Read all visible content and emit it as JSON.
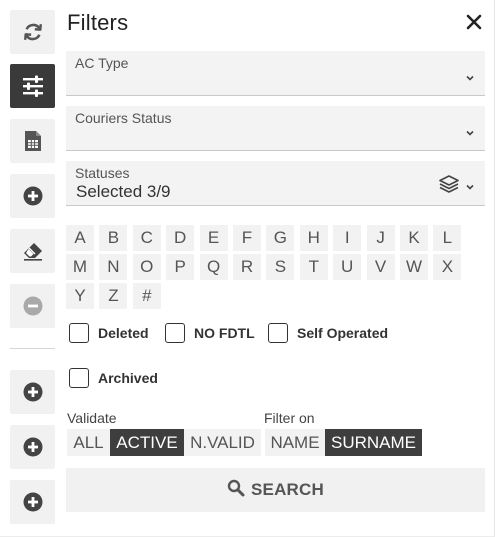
{
  "panel": {
    "title": "Filters"
  },
  "rail": {
    "items": [
      {
        "icon": "refresh-icon",
        "active": false
      },
      {
        "icon": "sliders-icon",
        "active": true
      },
      {
        "icon": "spreadsheet-icon",
        "active": false
      },
      {
        "icon": "plus-circle-icon",
        "active": false
      },
      {
        "icon": "eraser-icon",
        "active": false
      },
      {
        "icon": "minus-circle-icon",
        "active": false
      },
      {
        "icon": "plus-circle-icon",
        "active": false
      },
      {
        "icon": "plus-circle-icon",
        "active": false
      },
      {
        "icon": "plus-circle-icon",
        "active": false
      }
    ]
  },
  "fields": {
    "ac_type": {
      "label": "AC Type",
      "value": ""
    },
    "couriers_status": {
      "label": "Couriers Status",
      "value": ""
    },
    "statuses": {
      "label": "Statuses",
      "value": "Selected 3/9"
    }
  },
  "letters": [
    "A",
    "B",
    "C",
    "D",
    "E",
    "F",
    "G",
    "H",
    "I",
    "J",
    "K",
    "L",
    "M",
    "N",
    "O",
    "P",
    "Q",
    "R",
    "S",
    "T",
    "U",
    "V",
    "W",
    "X",
    "Y",
    "Z",
    "#"
  ],
  "checkboxes": {
    "deleted": {
      "label": "Deleted",
      "checked": false
    },
    "no_fdtl": {
      "label": "NO FDTL",
      "checked": false
    },
    "self_operated": {
      "label": "Self Operated",
      "checked": false
    },
    "archived": {
      "label": "Archived",
      "checked": false
    }
  },
  "validate": {
    "label": "Validate",
    "options": [
      "ALL",
      "ACTIVE",
      "N.VALID"
    ],
    "selected": "ACTIVE"
  },
  "filter_on": {
    "label": "Filter on",
    "options": [
      "NAME",
      "SURNAME"
    ],
    "selected": "SURNAME"
  },
  "search": {
    "label": "SEARCH"
  },
  "colors": {
    "active_bg": "#3e3e3e",
    "field_bg": "#f3f3f3",
    "button_bg": "#f1f1f1"
  }
}
